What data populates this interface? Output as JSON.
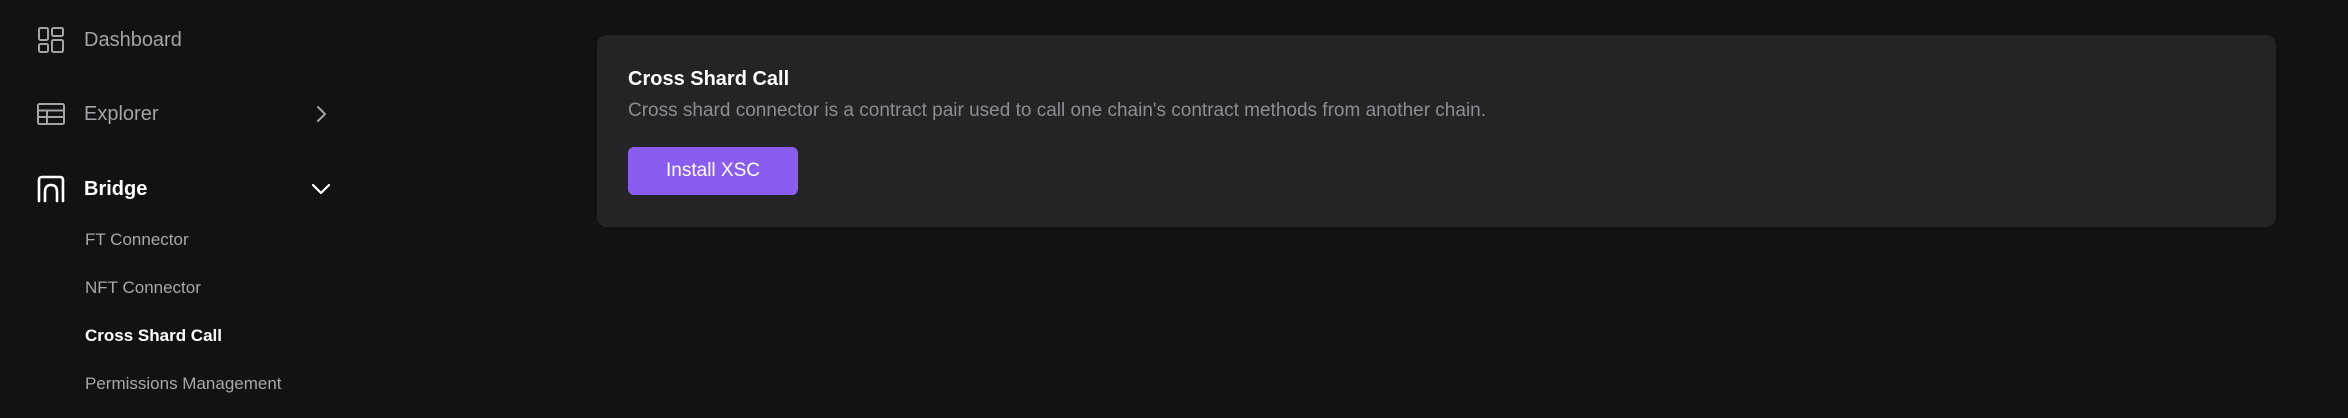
{
  "sidebar": {
    "items": [
      {
        "label": "Dashboard",
        "icon": "dashboard-icon"
      },
      {
        "label": "Explorer",
        "icon": "table-icon",
        "chevron": "chevron-right-icon"
      },
      {
        "label": "Bridge",
        "icon": "bridge-icon",
        "chevron": "chevron-down-icon",
        "expanded": true
      }
    ],
    "bridge_subitems": [
      {
        "label": "FT Connector"
      },
      {
        "label": "NFT Connector"
      },
      {
        "label": "Cross Shard Call",
        "active": true
      },
      {
        "label": "Permissions Management"
      }
    ]
  },
  "card": {
    "title": "Cross Shard Call",
    "description": "Cross shard connector is a contract pair used to call one chain's contract methods from another chain.",
    "button_label": "Install XSC"
  },
  "colors": {
    "background": "#121213",
    "card": "#242427",
    "accent": "#8b5cf0",
    "muted_text": "#8c8c92"
  }
}
